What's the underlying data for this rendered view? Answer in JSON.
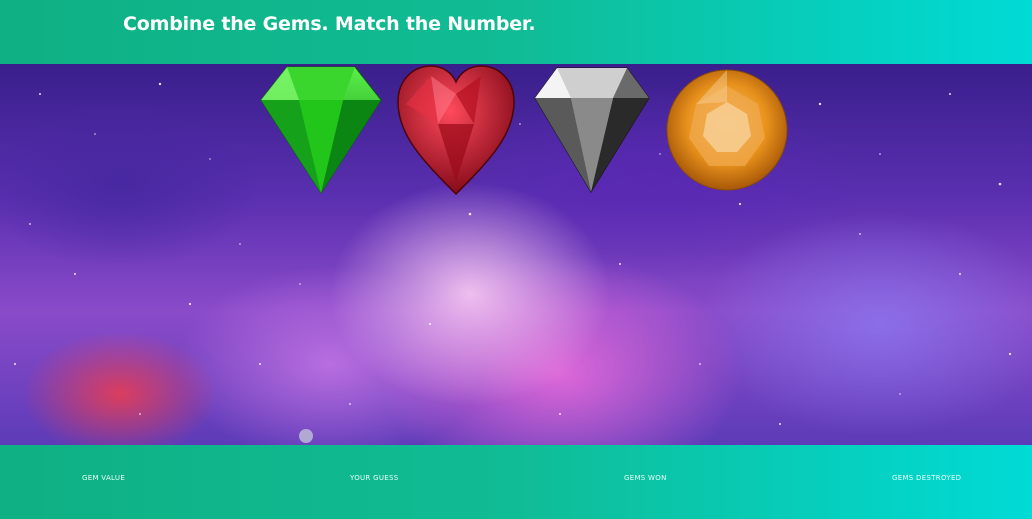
{
  "header": {
    "title": "Combine the Gems. Match the Number."
  },
  "gems": [
    {
      "name": "emerald",
      "color": "#22c51a"
    },
    {
      "name": "ruby-heart",
      "color": "#c8162a"
    },
    {
      "name": "diamond",
      "color": "#9a9a9a"
    },
    {
      "name": "topaz",
      "color": "#e8921c"
    }
  ],
  "stats": {
    "gem_value_label": "GEM VALUE",
    "your_guess_label": "YOUR GUESS",
    "gems_won_label": "GEMS WON",
    "gems_destroyed_label": "GEMS DESTROYED"
  }
}
